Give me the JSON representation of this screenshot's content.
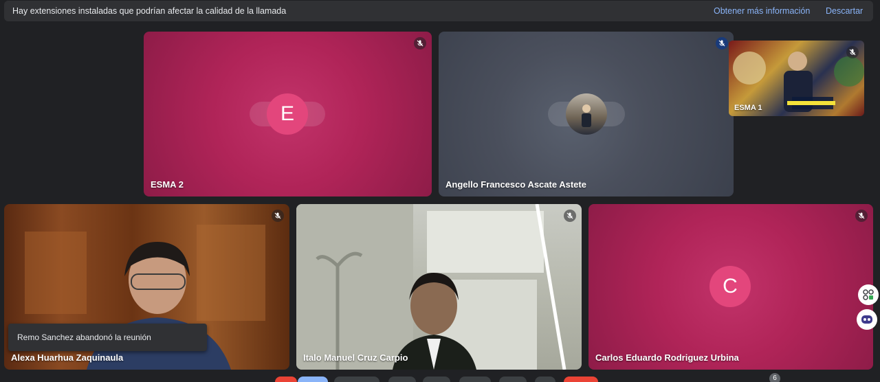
{
  "banner": {
    "message": "Hay extensiones instaladas que podrían afectar la calidad de la llamada",
    "more_info_label": "Obtener más información",
    "dismiss_label": "Descartar"
  },
  "participants": {
    "esma2": {
      "name": "ESMA 2",
      "initial": "E",
      "muted": true
    },
    "angello": {
      "name": "Angello Francesco Ascate Astete",
      "muted": true
    },
    "esma1": {
      "name": "ESMA 1",
      "muted": true
    },
    "alexa": {
      "name": "Alexa Huarhua Zaquinaula",
      "muted": true
    },
    "italo": {
      "name": "Italo Manuel Cruz Carpio",
      "muted": true
    },
    "carlos": {
      "name": "Carlos Eduardo Rodriguez Urbina",
      "initial": "C",
      "muted": true
    }
  },
  "toast": {
    "message": "Remo Sanchez abandonó la reunión"
  },
  "people_count": "6",
  "colors": {
    "accent_link": "#8ab4f8",
    "avatar_pink": "#e3467c",
    "tile_pink": "#b02458"
  }
}
